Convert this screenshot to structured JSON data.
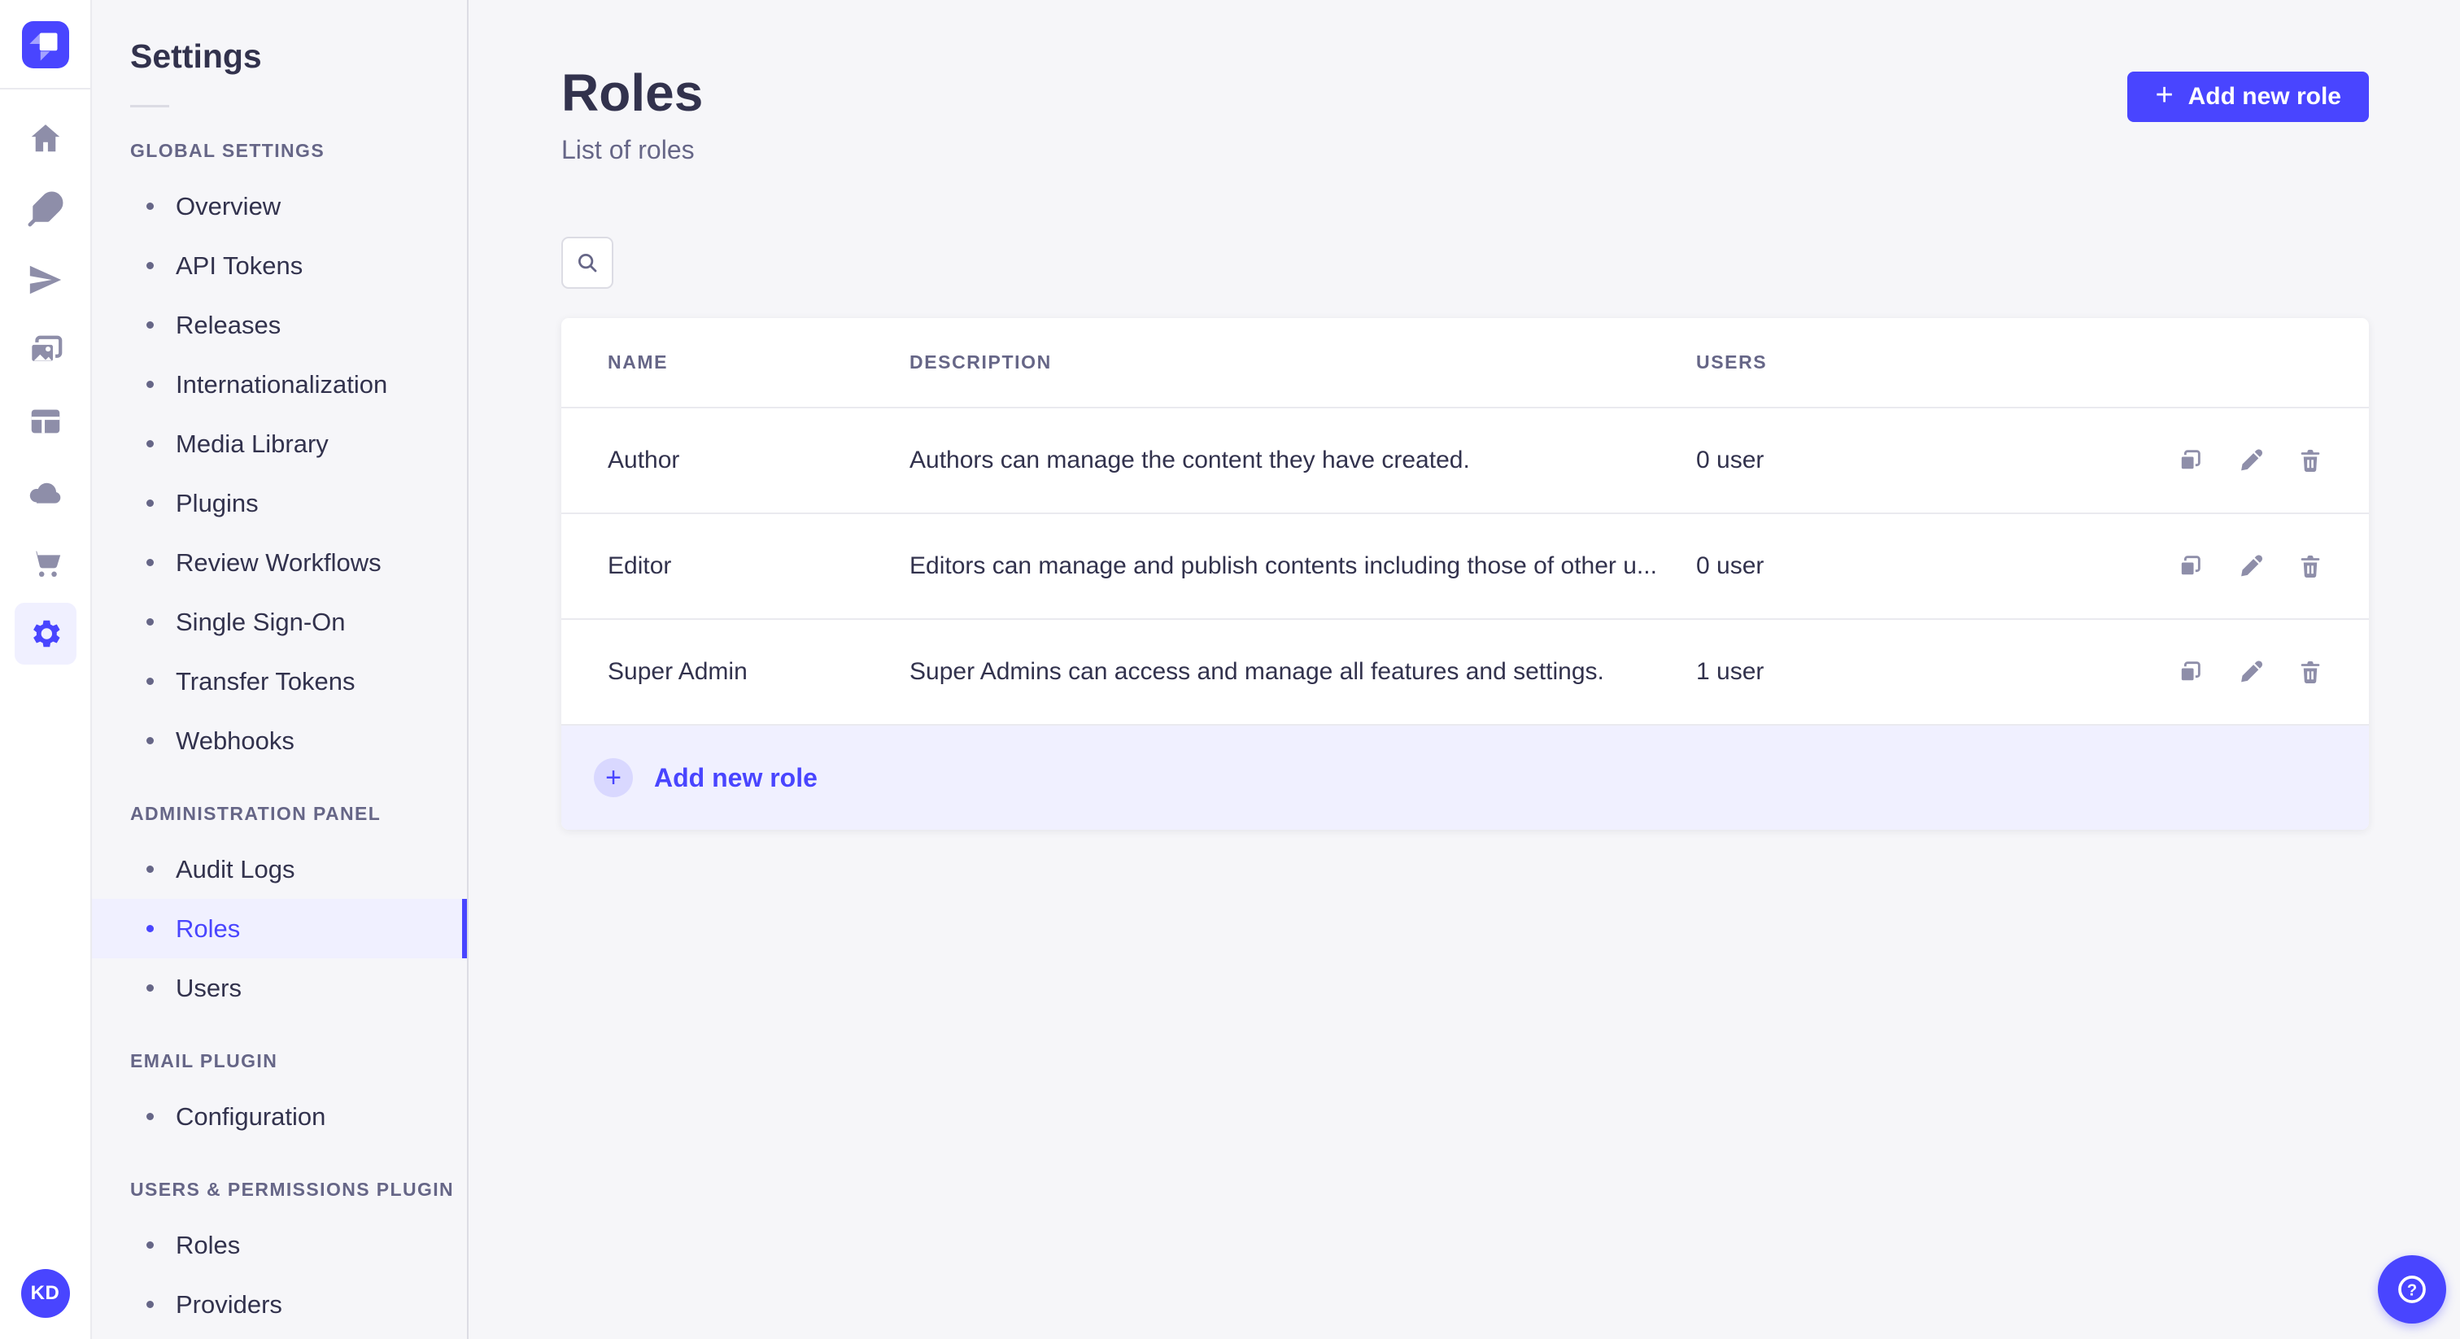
{
  "colors": {
    "primary": "#4945ff",
    "primary_light": "#f0f0ff",
    "primary_soft": "#d9d8ff",
    "text_dark": "#32324d",
    "text_muted": "#666687",
    "icon_gray": "#8e8ea9",
    "border": "#eaeaef",
    "background": "#f6f6f9"
  },
  "rail": {
    "logo_icon": "strapi-logo",
    "icons": [
      "home",
      "content-builder-feather",
      "send-plane",
      "media-images",
      "content-layout",
      "cloud",
      "marketplace-cart",
      "settings-gear"
    ],
    "active_icon": "settings-gear",
    "avatar_initials": "KD"
  },
  "settings_nav": {
    "title": "Settings",
    "sections": [
      {
        "label": "GLOBAL SETTINGS",
        "items": [
          {
            "label": "Overview"
          },
          {
            "label": "API Tokens"
          },
          {
            "label": "Releases"
          },
          {
            "label": "Internationalization"
          },
          {
            "label": "Media Library"
          },
          {
            "label": "Plugins"
          },
          {
            "label": "Review Workflows"
          },
          {
            "label": "Single Sign-On"
          },
          {
            "label": "Transfer Tokens"
          },
          {
            "label": "Webhooks"
          }
        ]
      },
      {
        "label": "ADMINISTRATION PANEL",
        "items": [
          {
            "label": "Audit Logs"
          },
          {
            "label": "Roles",
            "active": true
          },
          {
            "label": "Users"
          }
        ]
      },
      {
        "label": "EMAIL PLUGIN",
        "items": [
          {
            "label": "Configuration"
          }
        ]
      },
      {
        "label": "USERS & PERMISSIONS PLUGIN",
        "items": [
          {
            "label": "Roles"
          },
          {
            "label": "Providers"
          }
        ]
      }
    ]
  },
  "header": {
    "title": "Roles",
    "subtitle": "List of roles",
    "add_button_label": "Add new role"
  },
  "table": {
    "columns": [
      "NAME",
      "DESCRIPTION",
      "USERS"
    ],
    "rows": [
      {
        "name": "Author",
        "description": "Authors can manage the content they have created.",
        "users": "0 user"
      },
      {
        "name": "Editor",
        "description": "Editors can manage and publish contents including those of other u...",
        "users": "0 user"
      },
      {
        "name": "Super Admin",
        "description": "Super Admins can access and manage all features and settings.",
        "users": "1 user"
      }
    ],
    "row_actions": [
      "duplicate",
      "edit",
      "delete"
    ],
    "footer_action_label": "Add new role"
  }
}
